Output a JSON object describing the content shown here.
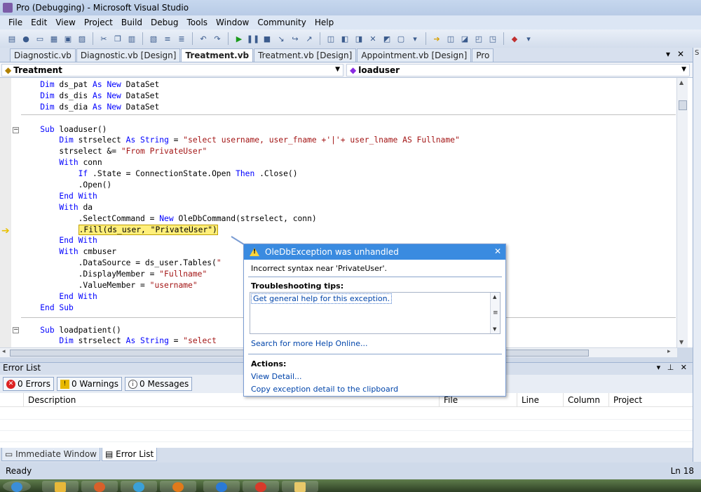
{
  "window": {
    "title": "Pro (Debugging) - Microsoft Visual Studio"
  },
  "menu": [
    "File",
    "Edit",
    "View",
    "Project",
    "Build",
    "Debug",
    "Tools",
    "Window",
    "Community",
    "Help"
  ],
  "doc_tabs": [
    {
      "label": "Diagnostic.vb",
      "active": false
    },
    {
      "label": "Diagnostic.vb [Design]",
      "active": false
    },
    {
      "label": "Treatment.vb",
      "active": true
    },
    {
      "label": "Treatment.vb [Design]",
      "active": false
    },
    {
      "label": "Appointment.vb [Design]",
      "active": false
    },
    {
      "label": "Pro",
      "active": false
    }
  ],
  "dropdowns": {
    "class_name": "Treatment",
    "method_name": "loaduser"
  },
  "code": {
    "lines": [
      "Dim ds_pat As New DataSet",
      "Dim ds_dis As New DataSet",
      "Dim ds_dia As New DataSet",
      "",
      "Sub loaduser()",
      "Dim strselect As String = \"select username, user_fname +'|'+ user_lname AS Fullname\"",
      "strselect &= \"From PrivateUser\"",
      "With conn",
      "If .State = ConnectionState.Open Then .Close()",
      ".Open()",
      "End With",
      "With da",
      ".SelectCommand = New OleDbCommand(strselect, conn)",
      ".Fill(ds_user, \"PrivateUser\")",
      "End With",
      "With cmbuser",
      ".DataSource = ds_user.Tables(\"",
      ".DisplayMember = \"Fullname\"",
      ".ValueMember = \"username\"",
      "End With",
      "End Sub",
      "",
      "Sub loadpatient()",
      "Dim strselect As String = \"select"
    ]
  },
  "exception": {
    "title": "OleDbException was unhandled",
    "message": "Incorrect syntax near 'PrivateUser'.",
    "tips_heading": "Troubleshooting tips:",
    "tip_link": "Get general help for this exception.",
    "search_link": "Search for more Help Online...",
    "actions_heading": "Actions:",
    "view_detail": "View Detail...",
    "copy_detail": "Copy exception detail to the clipboard",
    "close_glyph": "✕"
  },
  "error_list": {
    "title": "Error List",
    "errors": "0 Errors",
    "warnings": "0 Warnings",
    "messages": "0 Messages",
    "columns": [
      "Description",
      "File",
      "Line",
      "Column",
      "Project"
    ]
  },
  "bottom_tabs": [
    {
      "label": "Immediate Window",
      "active": false
    },
    {
      "label": "Error List",
      "active": true
    }
  ],
  "status": {
    "left": "Ready",
    "right": "Ln 18"
  },
  "colors": {
    "keyword": "#0000ff",
    "string": "#a31515",
    "exception_title_bg": "#3a8be0",
    "current_line": "#ffef7a"
  }
}
